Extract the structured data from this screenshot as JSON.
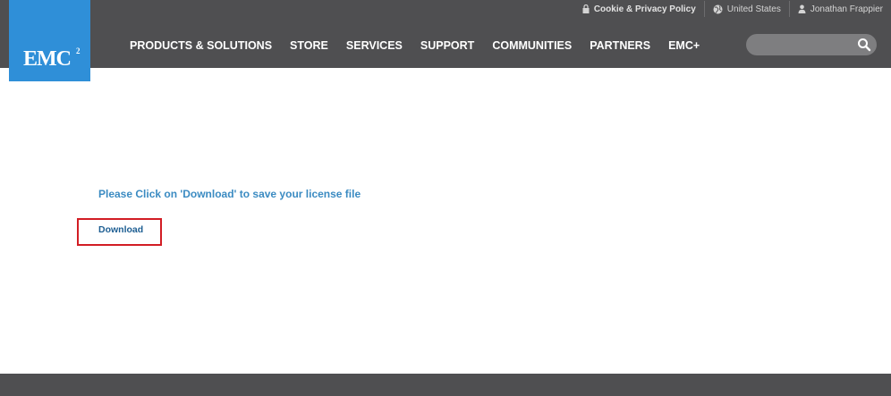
{
  "brand": {
    "logo_text": "EMC",
    "logo_superscript": "2",
    "logo_color": "#2f8fd8"
  },
  "utility_bar": {
    "privacy": "Cookie & Privacy Policy",
    "region": "United States",
    "user": "Jonathan Frappier"
  },
  "nav": {
    "items": [
      "PRODUCTS & SOLUTIONS",
      "STORE",
      "SERVICES",
      "SUPPORT",
      "COMMUNITIES",
      "PARTNERS",
      "EMC+"
    ]
  },
  "search": {
    "placeholder": ""
  },
  "main": {
    "message": "Please Click on 'Download' to save your license file",
    "download_label": "Download"
  },
  "colors": {
    "header": "#4f4f51",
    "accent": "#3b8bc2",
    "link": "#1d5e92",
    "highlight": "#d21d24"
  }
}
